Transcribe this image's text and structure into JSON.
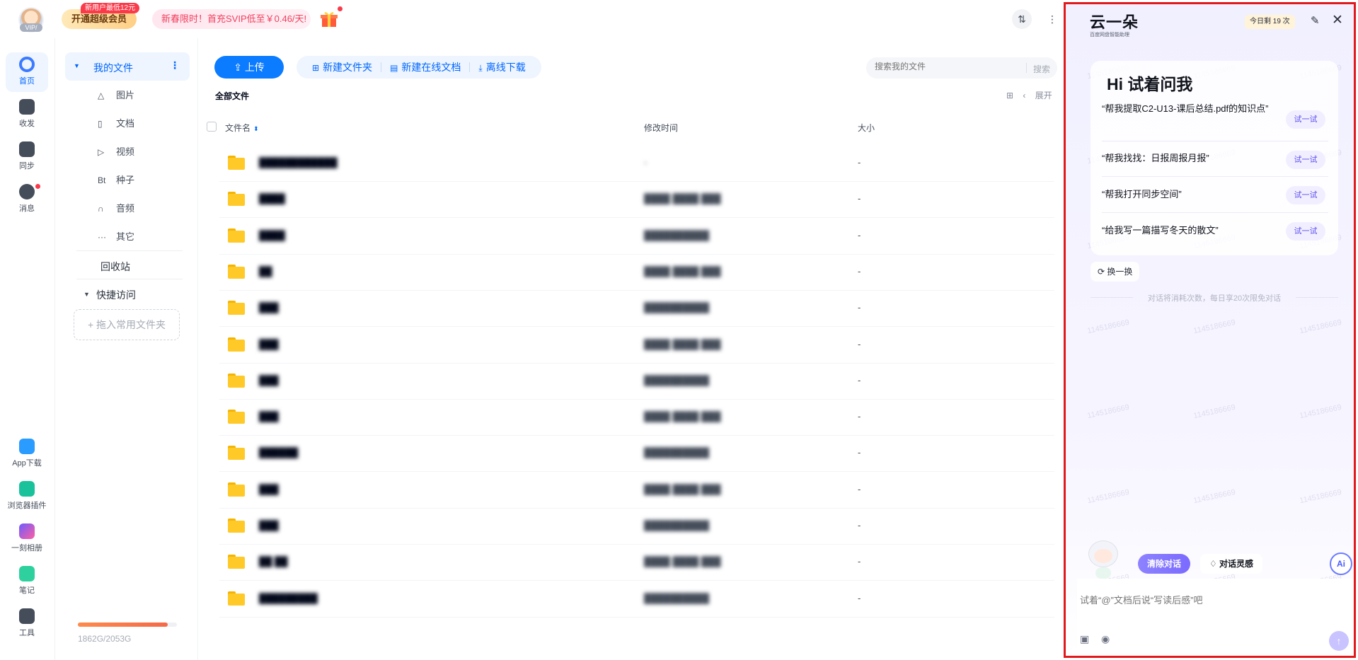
{
  "topbar": {
    "vip_label": "VIP/",
    "svip_button": "开通超级会员",
    "svip_badge": "新用户最低12元",
    "promo_text": "新春限时！首充SVIP低至￥0.46/天!",
    "transfer_icon": "⇅",
    "more_icon": "⋮"
  },
  "rail": {
    "items": [
      {
        "label": "首页",
        "icon": "home-icon",
        "color": "#3a7bff"
      },
      {
        "label": "收发",
        "icon": "share-icon",
        "color": "#454d5a"
      },
      {
        "label": "同步",
        "icon": "sync-icon",
        "color": "#454d5a"
      },
      {
        "label": "消息",
        "icon": "message-icon",
        "color": "#454d5a"
      },
      {
        "label": "App下载",
        "icon": "app-download-icon",
        "color": "#2a9bff"
      },
      {
        "label": "浏览器插件",
        "icon": "browser-plugin-icon",
        "color": "#19c29a"
      },
      {
        "label": "一刻相册",
        "icon": "album-icon",
        "color": "#6c5cff"
      },
      {
        "label": "笔记",
        "icon": "notes-icon",
        "color": "#2ed19e"
      },
      {
        "label": "工具",
        "icon": "tools-icon",
        "color": "#454d5a"
      }
    ]
  },
  "tree": {
    "my_files": "我的文件",
    "categories": [
      {
        "icon": "△",
        "label": "图片"
      },
      {
        "icon": "▯",
        "label": "文档"
      },
      {
        "icon": "▷",
        "label": "视频"
      },
      {
        "icon": "Bt",
        "label": "种子"
      },
      {
        "icon": "∩",
        "label": "音频"
      },
      {
        "icon": "···",
        "label": "其它"
      }
    ],
    "recycle": "回收站",
    "quick_access": "快捷访问",
    "drop_hint": "+ 拖入常用文件夹",
    "quota_text": "1862G/2053G",
    "quota_fraction": 0.907
  },
  "main": {
    "upload": "上传",
    "new_folder": "新建文件夹",
    "new_doc": "新建在线文档",
    "offline_download": "离线下载",
    "search_placeholder": "搜索我的文件",
    "search_button": "搜索",
    "breadcrumb": "全部文件",
    "expand": "展开",
    "columns": {
      "name": "文件名",
      "modified": "修改时间",
      "size": "大小"
    },
    "rows": [
      {
        "name": "████████████",
        "time": "-",
        "size": "-"
      },
      {
        "name": "████",
        "time": "████ ████ ███",
        "size": "-"
      },
      {
        "name": "████",
        "time": "██████████",
        "size": "-"
      },
      {
        "name": "██",
        "time": "████ ████ ███",
        "size": "-"
      },
      {
        "name": "███",
        "time": "██████████",
        "size": "-"
      },
      {
        "name": "███",
        "time": "████ ████ ███",
        "size": "-"
      },
      {
        "name": "███",
        "time": "██████████",
        "size": "-"
      },
      {
        "name": "███",
        "time": "████ ████ ███",
        "size": "-"
      },
      {
        "name": "██████",
        "time": "██████████",
        "size": "-"
      },
      {
        "name": "███",
        "time": "████ ████ ███",
        "size": "-"
      },
      {
        "name": "███",
        "time": "██████████",
        "size": "-"
      },
      {
        "name": "██ ██",
        "time": "████ ████ ███",
        "size": "-"
      },
      {
        "name": "█████████",
        "time": "██████████",
        "size": "-"
      }
    ]
  },
  "ai": {
    "logo": "云一朵",
    "logo_sub": "百度网盘智能助理",
    "quota": "今日剩 19 次",
    "greeting": "Hi 试着问我",
    "questions": [
      "“帮我提取C2-U13-课后总结.pdf的知识点”",
      "“帮我找找：日报周报月报”",
      "“帮我打开同步空间”",
      "“给我写一篇描写冬天的散文”"
    ],
    "try_label": "试一试",
    "swap": "换一换",
    "note": "对话将消耗次数，每日享20次限免对话",
    "clear": "清除对话",
    "inspire": "对话灵感",
    "ai_fab": "Ai",
    "input_placeholder": "试着“@”文档后说“写读后感”吧",
    "watermark": "1145186669"
  }
}
